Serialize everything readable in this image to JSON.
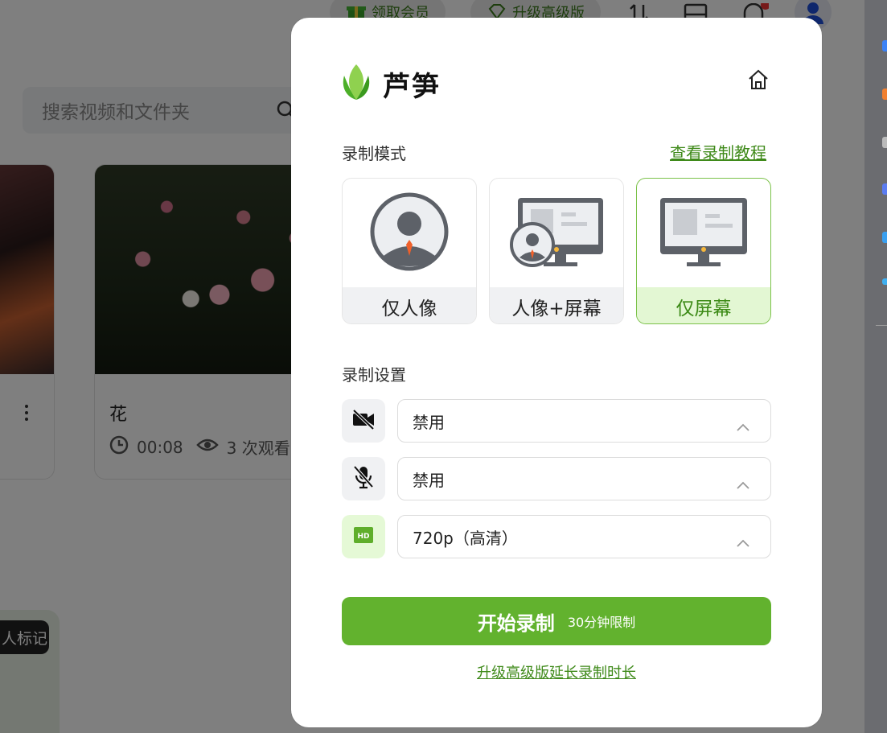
{
  "background": {
    "top_pills": [
      {
        "label": "领取会员",
        "icon": "gift-icon"
      },
      {
        "label": "升级高级版",
        "icon": "diamond-icon"
      }
    ],
    "search_placeholder": "搜索视频和文件夹",
    "card": {
      "title": "花",
      "duration": "00:08",
      "views": "3 次观看"
    },
    "tag_label": "人标记"
  },
  "modal": {
    "brand": "芦笋",
    "record_mode_label": "录制模式",
    "tutorial_link": "查看录制教程",
    "modes": [
      {
        "label": "仅人像",
        "icon": "person-icon",
        "active": false
      },
      {
        "label": "人像+屏幕",
        "icon": "person-screen-icon",
        "active": false
      },
      {
        "label": "仅屏幕",
        "icon": "screen-icon",
        "active": true
      }
    ],
    "record_settings_label": "录制设置",
    "settings": [
      {
        "icon": "camera-off-icon",
        "value": "禁用"
      },
      {
        "icon": "mic-off-icon",
        "value": "禁用"
      },
      {
        "icon": "hd-icon",
        "value": "720p（高清）"
      }
    ],
    "start_button": {
      "label": "开始录制",
      "limit": "30分钟限制"
    },
    "upgrade_link": "升级高级版延长录制时长"
  },
  "colors": {
    "accent": "#62b22e",
    "link": "#3f8a1a",
    "active_mode_bg": "#e3f7d3"
  }
}
